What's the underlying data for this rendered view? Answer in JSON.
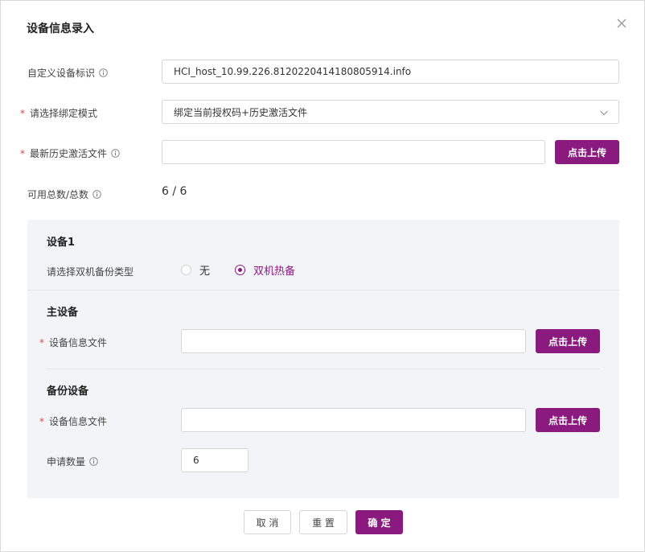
{
  "dialog": {
    "title": "设备信息录入"
  },
  "form": {
    "custom_id": {
      "label": "自定义设备标识",
      "value": "HCI_host_10.99.226.8120220414180805914.info"
    },
    "bind_mode": {
      "label": "请选择绑定模式",
      "value": "绑定当前授权码+历史激活文件"
    },
    "latest_file": {
      "label": "最新历史激活文件",
      "value": "",
      "upload_label": "点击上传"
    },
    "available": {
      "label": "可用总数/总数",
      "value": "6 / 6"
    }
  },
  "device": {
    "title": "设备1",
    "backup_type_label": "请选择双机备份类型",
    "options": [
      {
        "label": "无",
        "checked": false
      },
      {
        "label": "双机热备",
        "checked": true
      }
    ],
    "primary": {
      "title": "主设备",
      "file_label": "设备信息文件",
      "file_value": "",
      "upload_label": "点击上传"
    },
    "backup": {
      "title": "备份设备",
      "file_label": "设备信息文件",
      "file_value": "",
      "upload_label": "点击上传",
      "quantity_label": "申请数量",
      "quantity_value": "6"
    }
  },
  "footer": {
    "cancel": "取 消",
    "reset": "重 置",
    "confirm": "确 定"
  },
  "colors": {
    "accent": "#8b1a7f",
    "required": "#e04848",
    "panel_bg": "#f2f4f8"
  }
}
